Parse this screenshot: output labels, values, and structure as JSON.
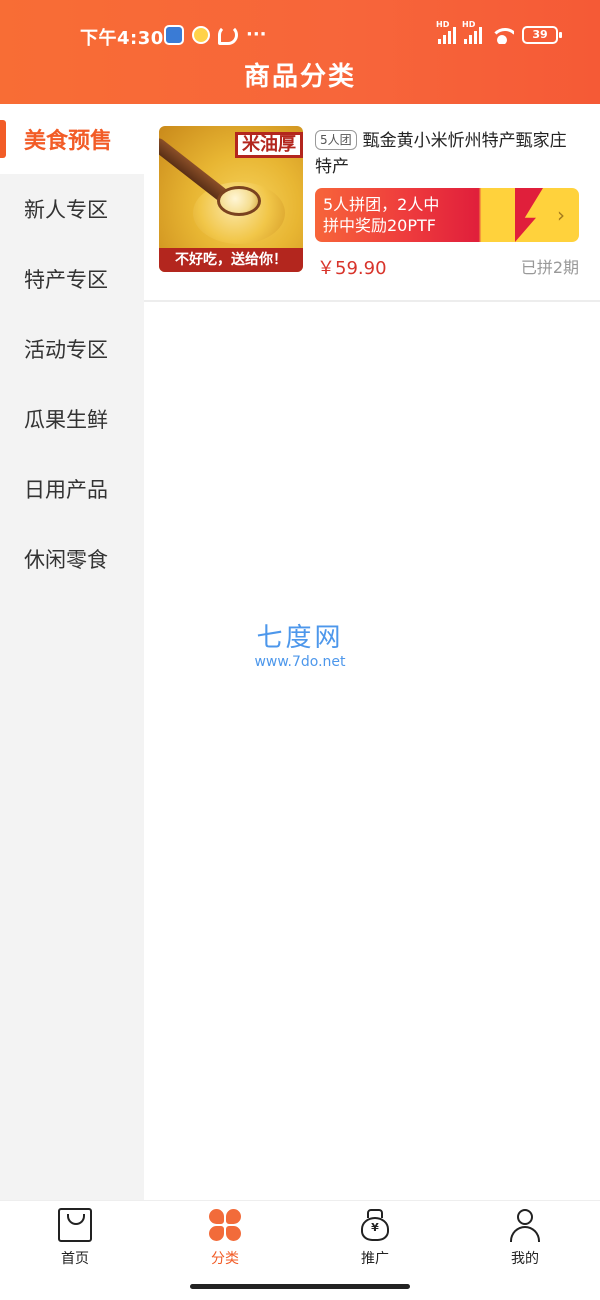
{
  "status_bar": {
    "time": "下午4:30",
    "hd_label": "HD",
    "battery": "39"
  },
  "header": {
    "title": "商品分类"
  },
  "sidebar": {
    "items": [
      {
        "label": "美食预售"
      },
      {
        "label": "新人专区"
      },
      {
        "label": "特产专区"
      },
      {
        "label": "活动专区"
      },
      {
        "label": "瓜果生鲜"
      },
      {
        "label": "日用产品"
      },
      {
        "label": "休闲零食"
      }
    ]
  },
  "product": {
    "image_tag": "米油厚",
    "image_banner": "不好吃，送给你！",
    "group_badge": "5人团",
    "title": "甄金黄小米忻州特产甄家庄特产",
    "promo_line1": "5人拼团，2人中",
    "promo_line2": "拼中奖励20PTF",
    "price": "￥59.90",
    "sold": "已拼2期"
  },
  "watermark": {
    "main": "七度网",
    "sub": "www.7do.net"
  },
  "tabbar": {
    "tabs": [
      {
        "label": "首页",
        "icon": "home-bag-icon"
      },
      {
        "label": "分类",
        "icon": "category-icon"
      },
      {
        "label": "推广",
        "icon": "money-bag-icon"
      },
      {
        "label": "我的",
        "icon": "user-icon"
      }
    ],
    "bag_symbol": "¥"
  },
  "colors": {
    "accent": "#f25c27",
    "header_gradient_start": "#f86d35",
    "price": "#d8342b",
    "promo_yellow": "#ffd23c"
  }
}
